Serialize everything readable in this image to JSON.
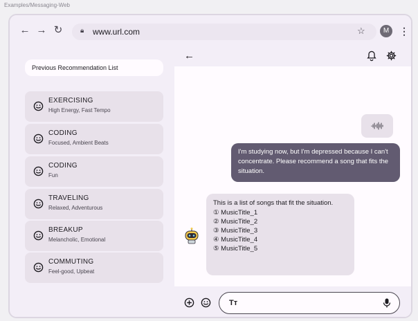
{
  "frame": {
    "label": "Examples/Messaging-Web"
  },
  "browser": {
    "url": "www.url.com",
    "avatar_letter": "M",
    "icons": [
      "back-arrow-icon",
      "forward-arrow-icon",
      "reload-icon",
      "lock-icon",
      "star-icon",
      "kebab-menu-icon"
    ]
  },
  "sidebar": {
    "header": "Previous Recommendation List",
    "items": [
      {
        "title": "EXERCISING",
        "subtitle": "High Energy, Fast Tempo",
        "icon": "smiley-icon"
      },
      {
        "title": "CODING",
        "subtitle": "Focused, Ambient Beats",
        "icon": "smiley-icon"
      },
      {
        "title": "CODING",
        "subtitle": "Fun",
        "icon": "smiley-icon"
      },
      {
        "title": "TRAVELING",
        "subtitle": "Relaxed, Adventurous",
        "icon": "smiley-icon"
      },
      {
        "title": "BREAKUP",
        "subtitle": "Melancholic, Emotional",
        "icon": "smiley-icon"
      },
      {
        "title": "COMMUTING",
        "subtitle": "Feel-good, Upbeat",
        "icon": "smiley-icon"
      }
    ]
  },
  "chat": {
    "top_icons": [
      "back-arrow-icon",
      "bell-icon",
      "settings-icon"
    ],
    "user_message": "I'm studying now, but I'm depressed because I can't concentrate. Please recommend a song that fits the situation.",
    "bot_message": {
      "intro": "This is a list of songs that fit the situation.",
      "songs": [
        "① MusicTitle_1",
        "② MusicTitle_2",
        "③ MusicTitle_3",
        "④ MusicTitle_4",
        "⑤ MusicTitle_5"
      ]
    },
    "composer": {
      "input_label": "Tт",
      "icons": [
        "add-icon",
        "emoji-icon",
        "mic-icon"
      ]
    }
  },
  "colors": {
    "surface": "#f3eef7",
    "card": "#e8e1ea",
    "user_bubble": "#625b71",
    "chat_background": "#fffbff"
  }
}
